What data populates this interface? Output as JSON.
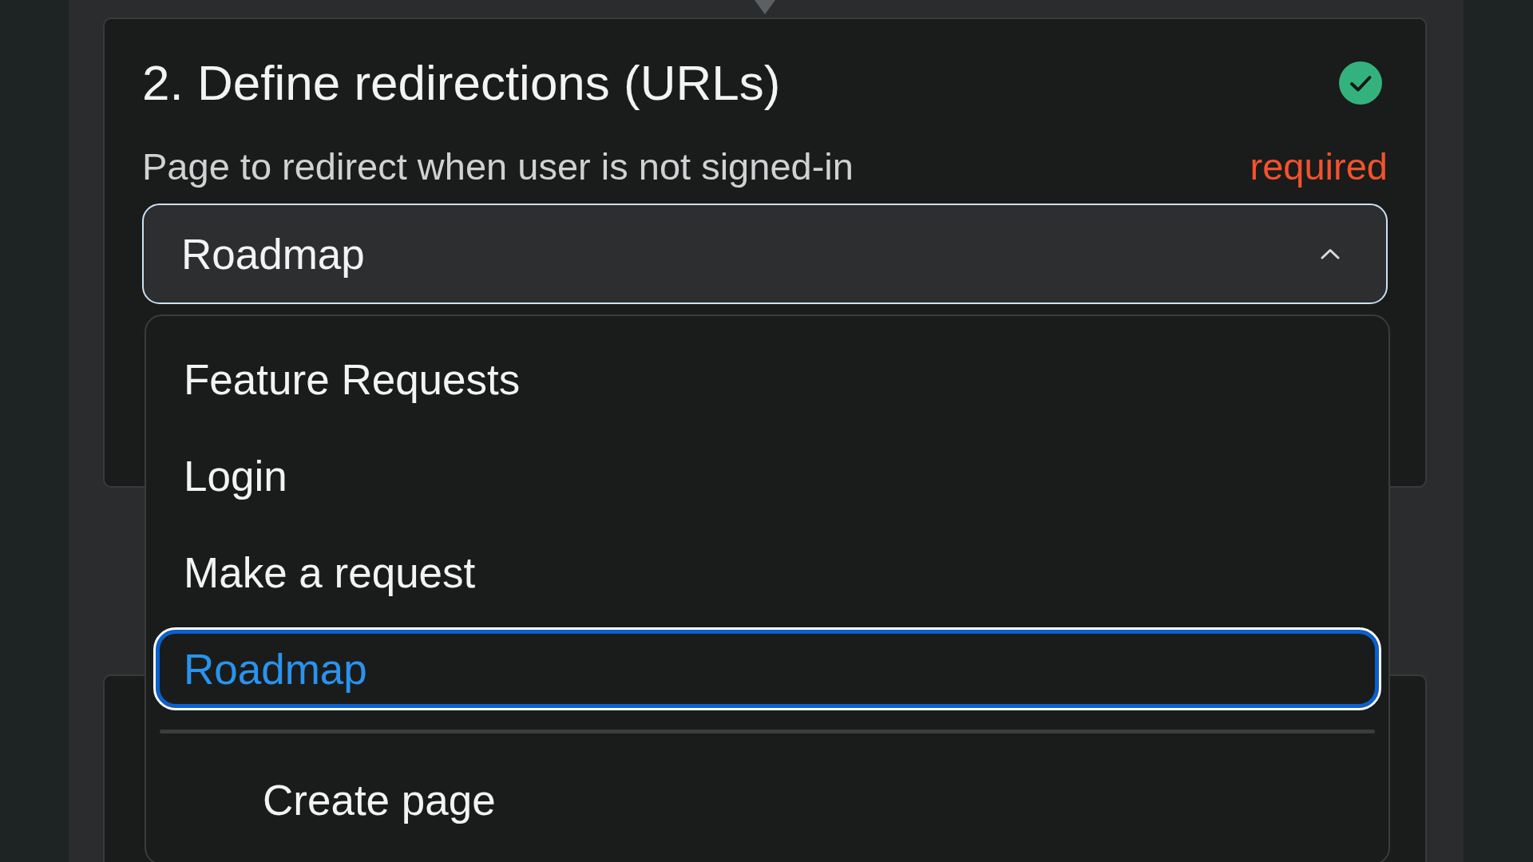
{
  "step": {
    "title": "2. Define redirections (URLs)",
    "complete": true,
    "field": {
      "label": "Page to redirect when user is not signed-in",
      "required_note": "required",
      "value": "Roadmap",
      "expanded": true,
      "options": [
        {
          "label": "Feature Requests",
          "selected": false
        },
        {
          "label": "Login",
          "selected": false
        },
        {
          "label": "Make a request",
          "selected": false
        },
        {
          "label": "Roadmap",
          "selected": true
        }
      ],
      "action": "Create page"
    }
  }
}
